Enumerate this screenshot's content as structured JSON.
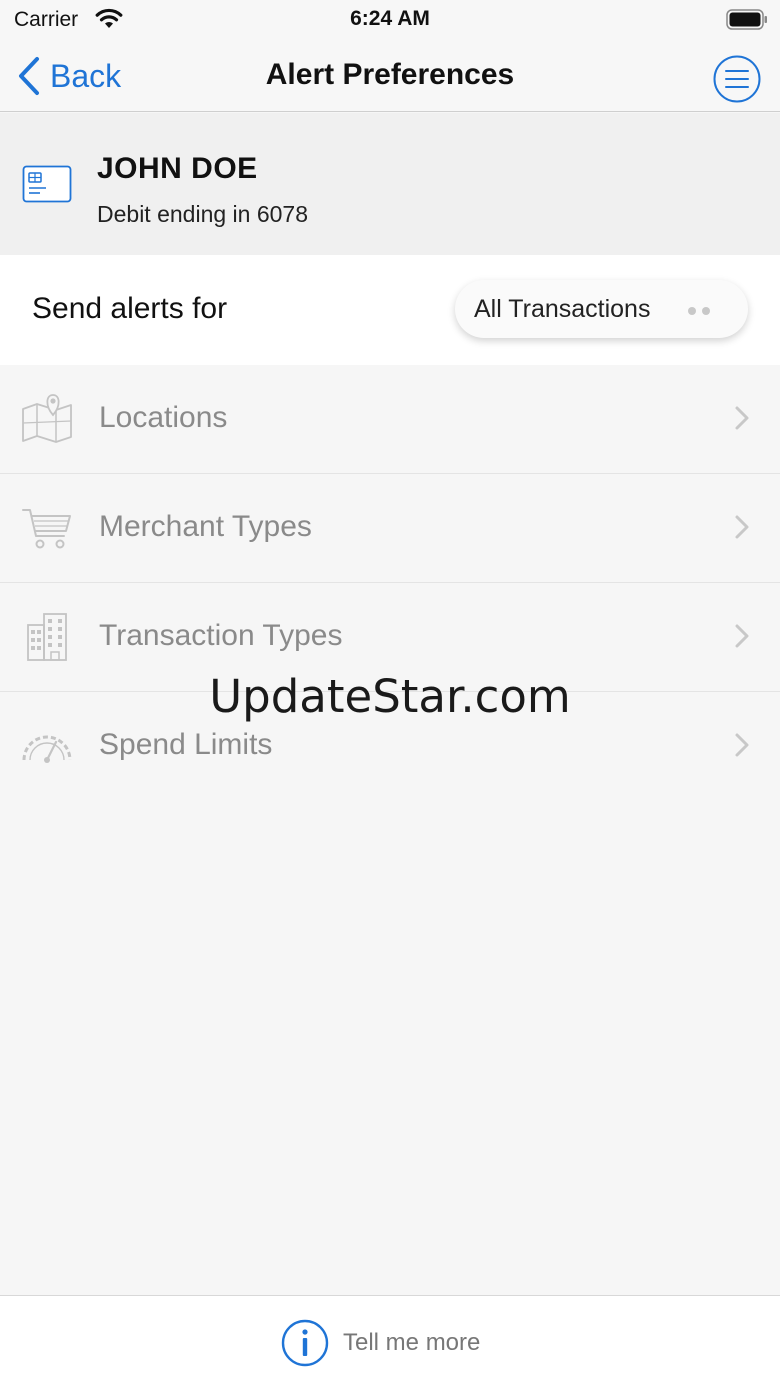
{
  "status": {
    "carrier": "Carrier",
    "time": "6:24 AM"
  },
  "nav": {
    "back_label": "Back",
    "title": "Alert Preferences"
  },
  "account": {
    "name": "JOHN DOE",
    "subtitle": "Debit ending in 6078"
  },
  "send_alerts": {
    "label": "Send alerts for",
    "selected": "All Transactions"
  },
  "menu": [
    {
      "label": "Locations",
      "icon": "map-pin-icon"
    },
    {
      "label": "Merchant Types",
      "icon": "shopping-cart-icon"
    },
    {
      "label": "Transaction Types",
      "icon": "building-icon"
    },
    {
      "label": "Spend Limits",
      "icon": "speedometer-icon"
    }
  ],
  "watermark": "UpdateStar.com",
  "footer": {
    "label": "Tell me more"
  },
  "colors": {
    "accent": "#1f74d6",
    "muted_text": "#8a8a8a",
    "background": "#f6f6f6"
  }
}
